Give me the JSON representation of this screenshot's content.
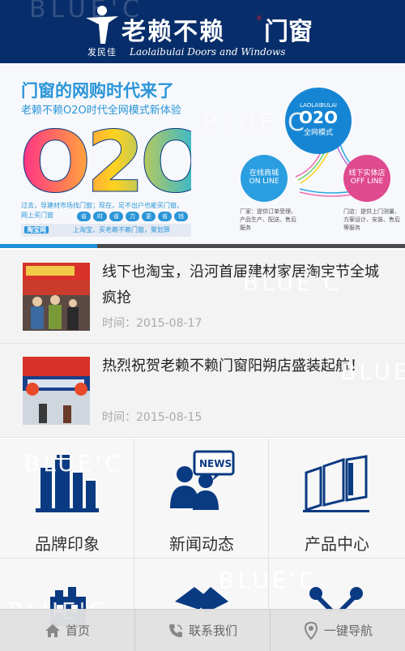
{
  "header": {
    "watermark": "BLUE'C",
    "logo_sub": "发民佳",
    "brand_name": "老赖不赖",
    "brand_reg": "®",
    "brand_suffix": "门窗",
    "brand_en": "Laolaibulai Doors and Windows"
  },
  "banner": {
    "title": "门窗的网购时代来了",
    "subtitle": "老赖不赖O2O时代全网模式新体验",
    "o2o_text": "O2O",
    "desc_line1": "过去，导建材市场找门窗；现在，足不出户也能买门窗。",
    "desc_line2": "网上买门窗",
    "dots": [
      "省",
      "时",
      "省",
      "力",
      "更",
      "省",
      "钱"
    ],
    "taobao_logo": "淘宝网",
    "taobao_text": "上淘宝，买老赖不赖门窗，聚划算",
    "center_en": "LAOLAIBULAI",
    "center_big": "O2O",
    "center_label": "全网模式",
    "left_circle_line1": "在线商城",
    "left_circle_line2": "ON LINE",
    "right_circle_line1": "线下实体店",
    "right_circle_line2": "OFF LINE",
    "left_caption": "厂家：提供订单受理、产品生产、配送、售后服务",
    "right_caption": "门店：提供上门测量、方案设计、安装、售后等服务",
    "watermark": "BLUE'C"
  },
  "news": [
    {
      "title": "线下也淘宝，沿河首届建材家居淘宝节全城疯抢",
      "time_label": "时间：",
      "time": "2015-08-17"
    },
    {
      "title": "热烈祝贺老赖不赖门窗阳朔店盛装起航！",
      "time_label": "时间：",
      "time": "2015-08-15"
    }
  ],
  "grid": {
    "items": [
      {
        "label": "品牌印象",
        "icon": "building-icon"
      },
      {
        "label": "新闻动态",
        "icon": "news-icon"
      },
      {
        "label": "产品中心",
        "icon": "windows-icon"
      },
      {
        "label": "",
        "icon": "store-icon"
      },
      {
        "label": "",
        "icon": "handshake-icon"
      },
      {
        "label": "",
        "icon": "tools-icon"
      }
    ],
    "watermark": "BLUE'C",
    "news_badge": "NEWS"
  },
  "bottom_nav": {
    "home": "首页",
    "contact": "联系我们",
    "navigate": "一键导航"
  },
  "colors": {
    "header_bg": "#072d6a",
    "accent_blue": "#1e90d6",
    "icon_blue": "#0a3a82"
  }
}
